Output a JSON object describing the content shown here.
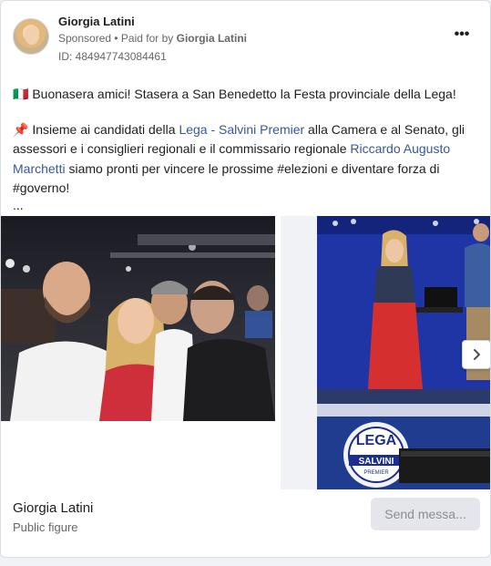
{
  "post": {
    "author": "Giorgia Latini",
    "sponsored": "Sponsored",
    "paid_for_prefix": "• Paid for by",
    "paid_for_by": "Giorgia Latini",
    "ad_id": "ID: 484947743084461",
    "more_icon": "more-options-icon",
    "paragraph1": "🇮🇹 Buonasera amici! Stasera a San Benedetto la Festa provinciale della Lega!",
    "p2_pin": "📌",
    "p2_part1": " Insieme ai candidati della ",
    "p2_link1": "Lega - Salvini Premier",
    "p2_part2": " alla Camera e al Senato, gli assessori e i consiglieri regionali e il commissario regionale ",
    "p2_link2": "Riccardo Augusto Marchetti",
    "p2_part3": " siamo pronti per vincere le prossime #elezioni e diventare forza di #governo!",
    "ellipsis": "..."
  },
  "carousel": {
    "next_icon": "chevron-right-icon",
    "sign_text": "LEGA",
    "sign_sub": "SALVINI",
    "sign_sub2": "PREMIER"
  },
  "footer": {
    "page_name": "Giorgia Latini",
    "page_category": "Public figure",
    "cta_label": "Send messa..."
  },
  "colors": {
    "link": "#385898",
    "secondary_text": "#65676b",
    "stage_blue": "#1b2d8f"
  }
}
